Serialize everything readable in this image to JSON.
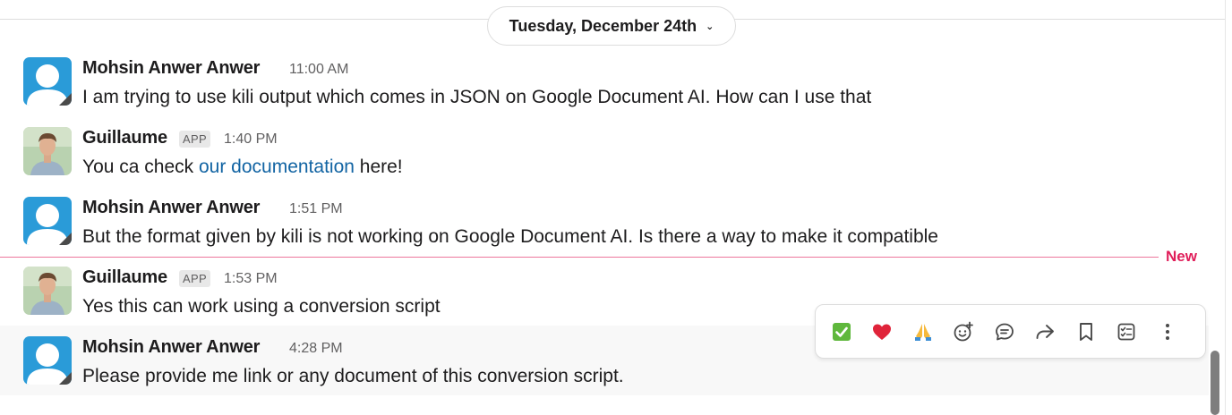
{
  "date_divider": {
    "label": "Tuesday, December 24th"
  },
  "new_marker": {
    "label": "New"
  },
  "messages": [
    {
      "sender": "Mohsin Anwer Anwer",
      "time": "11:00 AM",
      "text": "I am trying to use kili output which comes in JSON on Google Document AI. How can I use that"
    },
    {
      "sender": "Guillaume",
      "badge": "APP",
      "time": "1:40 PM",
      "text_before": "You ca check ",
      "link": "our documentation",
      "text_after": " here!"
    },
    {
      "sender": "Mohsin Anwer Anwer",
      "time": "1:51 PM",
      "text": "But the format given by kili is not working on Google Document AI. Is there a way to make it compatible"
    },
    {
      "sender": "Guillaume",
      "badge": "APP",
      "time": "1:53 PM",
      "text": "Yes this can work using a conversion script"
    },
    {
      "sender": "Mohsin Anwer Anwer",
      "time": "4:28 PM",
      "text": "Please provide me link or any document of this conversion script."
    }
  ],
  "actions": {
    "items": [
      "checkmark-reaction",
      "heart-reaction",
      "pray-reaction",
      "add-reaction",
      "reply-in-thread",
      "share",
      "save",
      "add-to-list",
      "more-actions"
    ]
  },
  "colors": {
    "link": "#1264a3",
    "new": "#e01e5a",
    "avatar_blue": "#2a9bd8"
  }
}
